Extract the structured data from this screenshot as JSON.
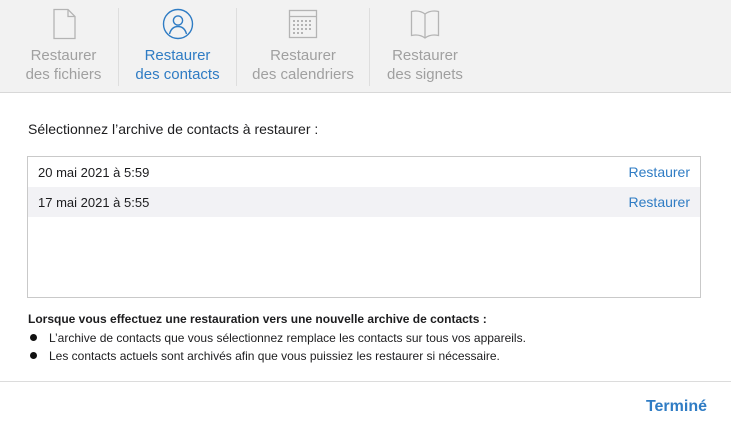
{
  "tabs": [
    {
      "line1": "Restaurer",
      "line2": "des fichiers",
      "icon": "document-icon",
      "active": false
    },
    {
      "line1": "Restaurer",
      "line2": "des contacts",
      "icon": "contact-icon",
      "active": true
    },
    {
      "line1": "Restaurer",
      "line2": "des calendriers",
      "icon": "calendar-icon",
      "active": false
    },
    {
      "line1": "Restaurer",
      "line2": "des signets",
      "icon": "book-icon",
      "active": false
    }
  ],
  "prompt": "Sélectionnez l’archive de contacts à restaurer :",
  "archives": [
    {
      "date": "20 mai 2021 à 5:59",
      "action": "Restaurer"
    },
    {
      "date": "17 mai 2021 à 5:55",
      "action": "Restaurer"
    }
  ],
  "note": {
    "title": "Lorsque vous effectuez une restauration vers une nouvelle archive de contacts :",
    "bullets": [
      "L’archive de contacts que vous sélectionnez remplace les contacts sur tous vos appareils.",
      "Les contacts actuels sont archivés afin que vous puissiez les restaurer si nécessaire."
    ]
  },
  "done_label": "Terminé",
  "colors": {
    "accent": "#2f7cc4",
    "inactive": "#a0a0a0",
    "tabbar_bg": "#f2f2f2",
    "row_alt": "#f2f2f5"
  }
}
